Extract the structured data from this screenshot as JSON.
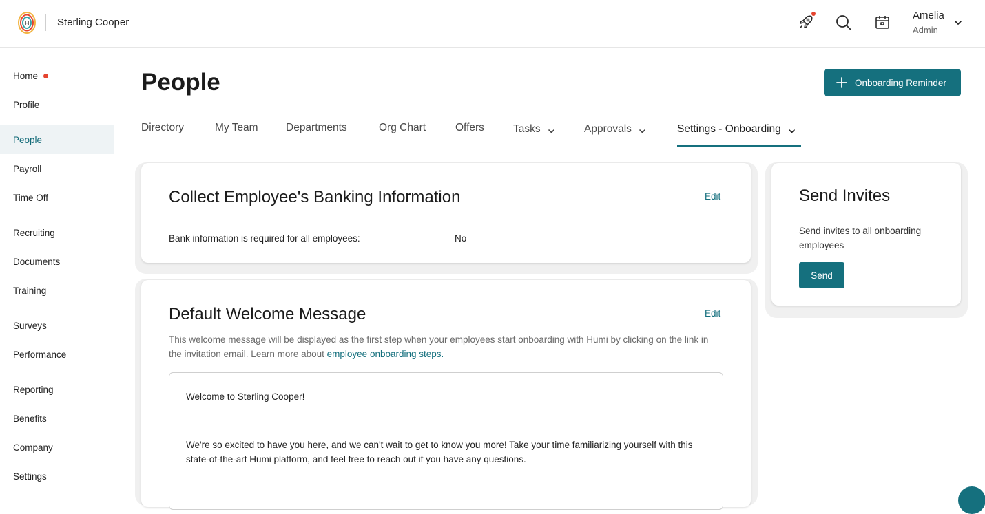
{
  "header": {
    "company_name": "Sterling Cooper",
    "user": {
      "name": "Amelia",
      "role": "Admin"
    },
    "icons": [
      "humi-logo-icon",
      "rocket-icon",
      "search-icon",
      "calendar-icon",
      "chevron-down-icon"
    ],
    "accent_color": "#15707e",
    "notification_color": "#e5442f"
  },
  "sidebar": {
    "items": [
      {
        "label": "Home",
        "has_dot": true
      },
      {
        "label": "Profile"
      },
      {
        "label": "People",
        "active": true
      },
      {
        "label": "Payroll"
      },
      {
        "label": "Time Off"
      },
      {
        "label": "Recruiting"
      },
      {
        "label": "Documents"
      },
      {
        "label": "Training"
      },
      {
        "label": "Surveys"
      },
      {
        "label": "Performance"
      },
      {
        "label": "Reporting"
      },
      {
        "label": "Benefits"
      },
      {
        "label": "Company"
      },
      {
        "label": "Settings"
      }
    ]
  },
  "main": {
    "title": "People",
    "primary_button": "Onboarding Reminder",
    "tabs": [
      {
        "label": "Directory"
      },
      {
        "label": "My Team"
      },
      {
        "label": "Departments"
      },
      {
        "label": "Org Chart"
      },
      {
        "label": "Offers"
      },
      {
        "label": "Tasks",
        "dropdown": true
      },
      {
        "label": "Approvals",
        "dropdown": true
      },
      {
        "label": "Settings - Onboarding",
        "dropdown": true,
        "active": true
      }
    ],
    "banking_card": {
      "title": "Collect Employee's Banking Information",
      "edit": "Edit",
      "field_label": "Bank information is required for all employees:",
      "field_value": "No"
    },
    "welcome_card": {
      "title": "Default Welcome Message",
      "edit": "Edit",
      "description": "This welcome message will be displayed as the first step when your employees start onboarding with Humi by clicking on the link in the invitation email. Learn more about",
      "description_link": "employee onboarding steps.",
      "message_greeting": "Welcome to Sterling Cooper!",
      "message_body": "We're so excited to have you here, and we can't wait to get to know you more! Take your time familiarizing yourself with this state-of-the-art Humi platform, and feel free to reach out if you have any questions."
    },
    "invites_card": {
      "title": "Send Invites",
      "description": "Send invites to all onboarding employees",
      "button": "Send"
    }
  }
}
